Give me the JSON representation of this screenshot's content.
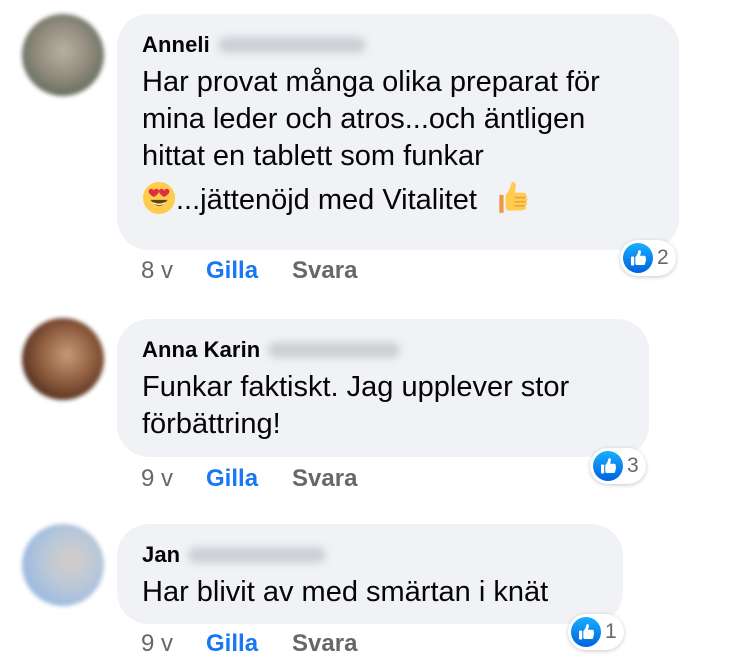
{
  "comments": [
    {
      "name": "Anneli",
      "text_lines": [
        "Har provat många olika preparat för",
        "mina leder och atros...och äntligen",
        "hittat en tablett som funkar"
      ],
      "last_line_text": "...jättenöjd med Vitalitet",
      "time": "8 v",
      "like_label": "Gilla",
      "reply_label": "Svara",
      "reaction_count": "2"
    },
    {
      "name": "Anna Karin",
      "text_lines": [
        "Funkar faktiskt. Jag upplever stor",
        "förbättring!"
      ],
      "time": "9 v",
      "like_label": "Gilla",
      "reply_label": "Svara",
      "reaction_count": "3"
    },
    {
      "name": "Jan",
      "text_lines": [
        "Har blivit av med smärtan i knät"
      ],
      "time": "9 v",
      "like_label": "Gilla",
      "reply_label": "Svara",
      "reaction_count": "1"
    }
  ],
  "icons": {
    "reaction": "like-thumb-icon",
    "emoji_heart_eyes": "heart-eyes-emoji-icon",
    "emoji_thumbs_up": "thumbs-up-emoji-icon"
  },
  "colors": {
    "bubble": "#f0f2f5",
    "like_blue": "#1877f2",
    "meta_gray": "#65676b"
  }
}
